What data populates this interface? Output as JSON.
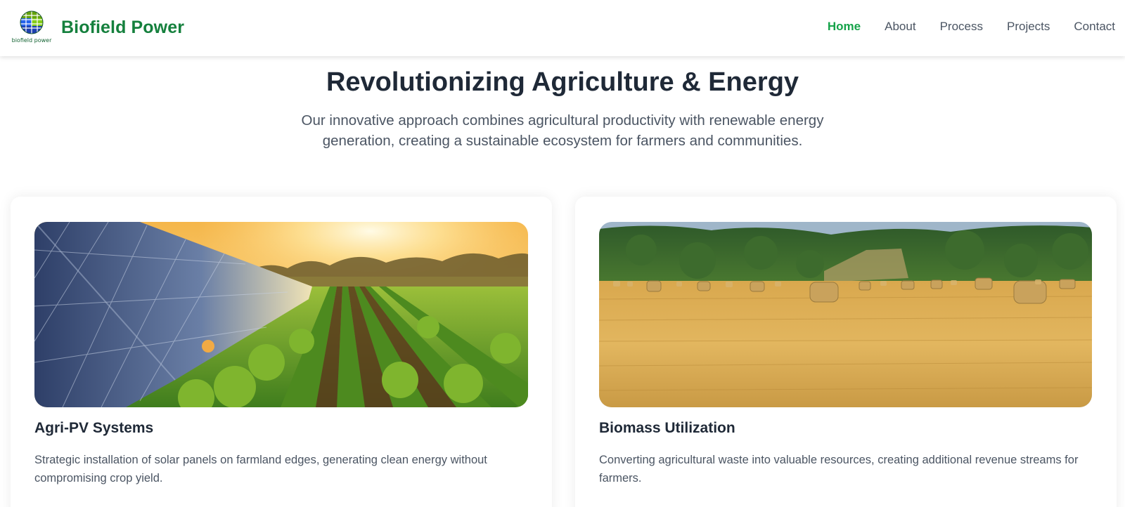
{
  "header": {
    "brand_name": "Biofield Power",
    "logo_caption": "biofield power",
    "nav": [
      {
        "label": "Home",
        "active": true
      },
      {
        "label": "About",
        "active": false
      },
      {
        "label": "Process",
        "active": false
      },
      {
        "label": "Projects",
        "active": false
      },
      {
        "label": "Contact",
        "active": false
      }
    ]
  },
  "hero": {
    "title": "Revolutionizing Agriculture & Energy",
    "subtitle": "Our innovative approach combines agricultural productivity with renewable energy generation, creating a sustainable ecosystem for farmers and communities."
  },
  "cards": [
    {
      "image": "solar-panels-crops-image",
      "title": "Agri-PV Systems",
      "text": "Strategic installation of solar panels on farmland edges, generating clean energy without compromising crop yield."
    },
    {
      "image": "hay-bales-field-image",
      "title": "Biomass Utilization",
      "text": "Converting agricultural waste into valuable resources, creating additional revenue streams for farmers."
    }
  ],
  "colors": {
    "brand": "#15803d",
    "nav_active": "#16a34a",
    "heading": "#1f2937",
    "body_text": "#4b5563"
  }
}
